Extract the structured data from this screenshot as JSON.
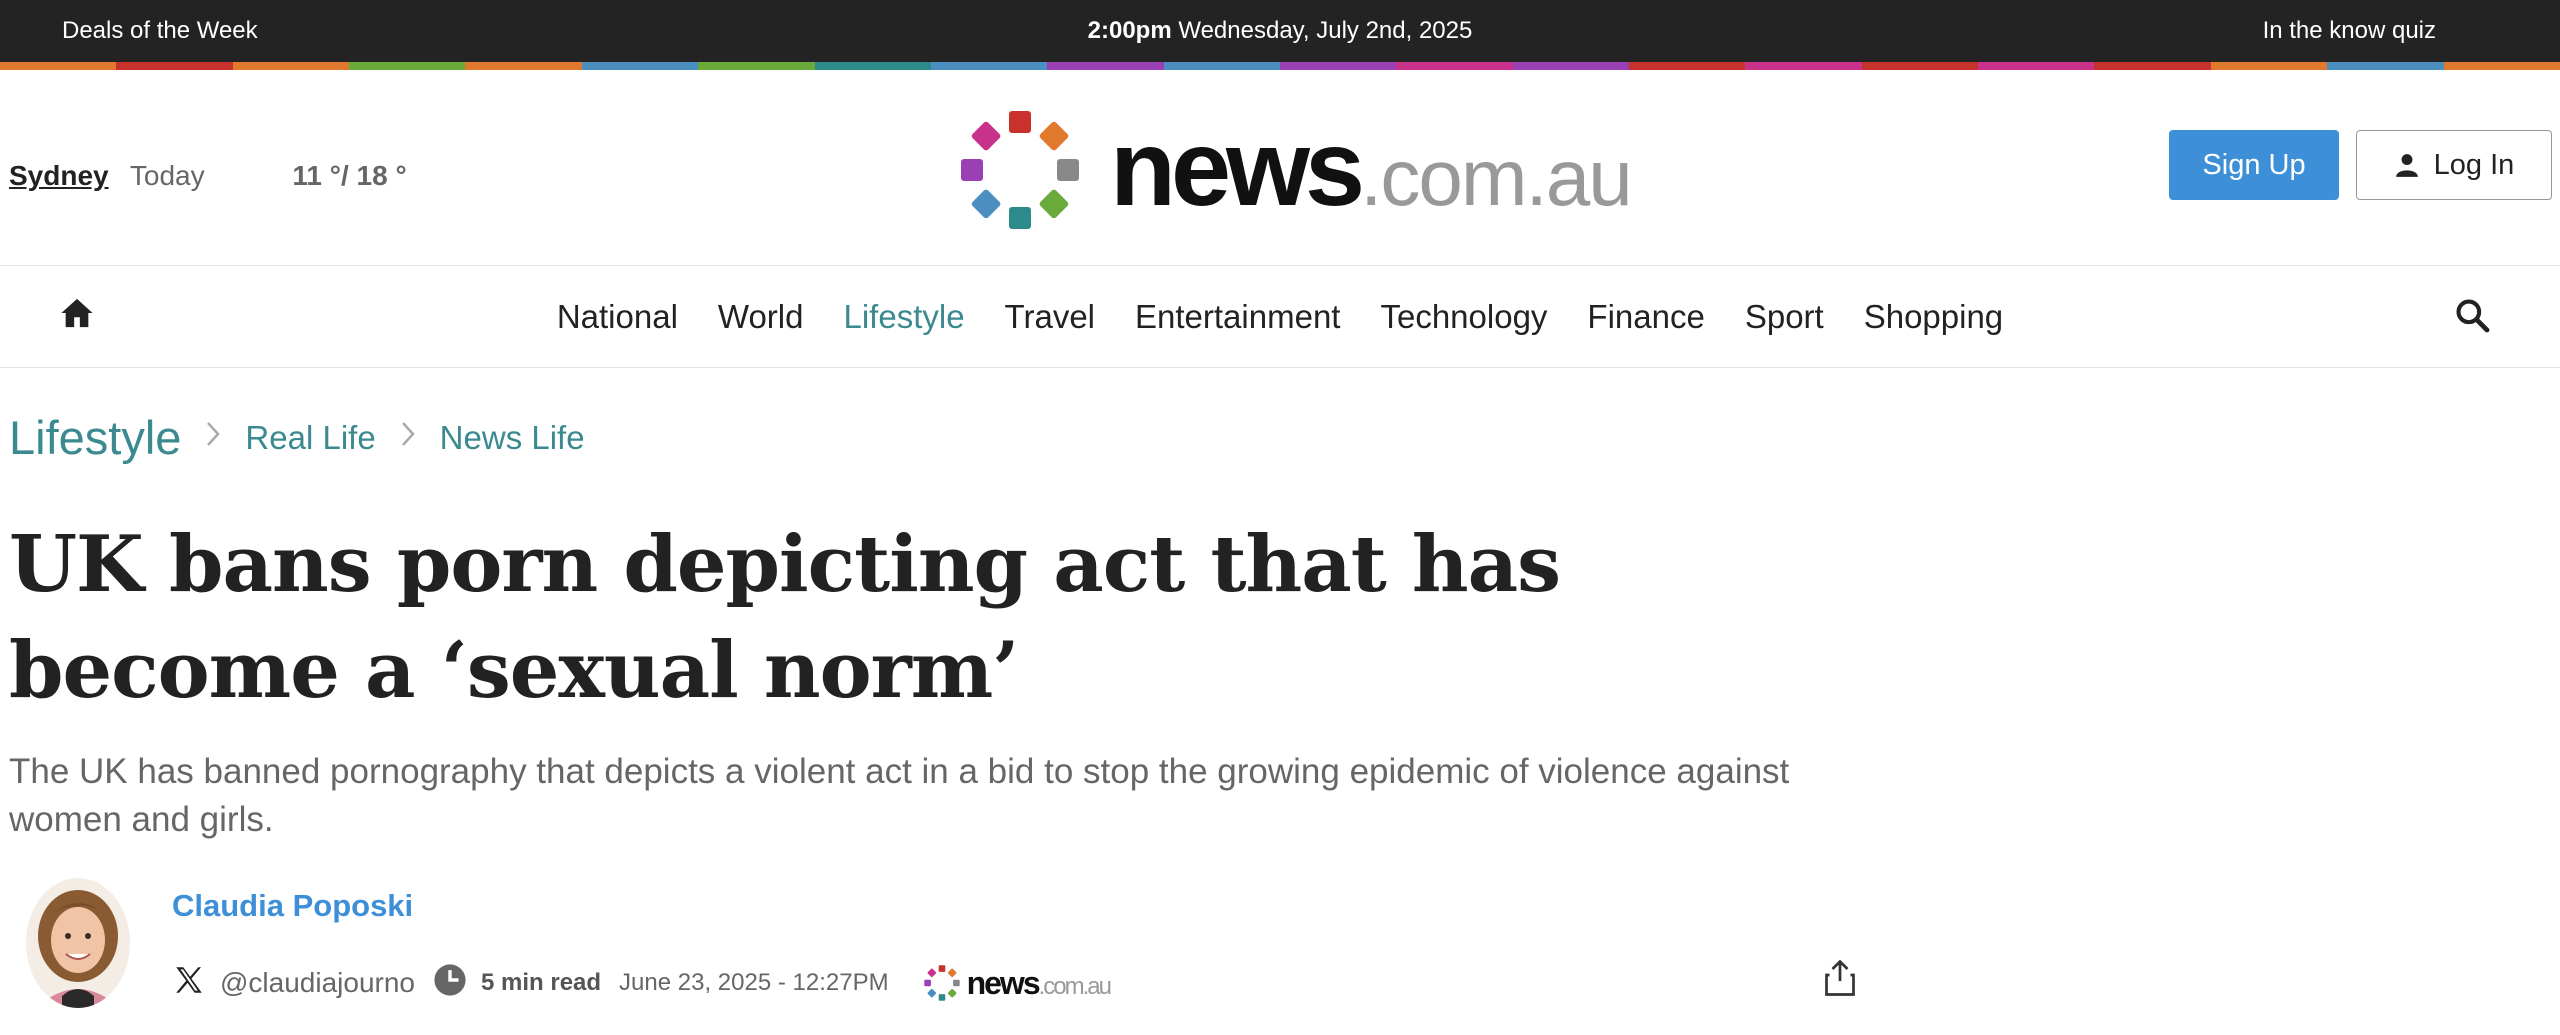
{
  "topbar": {
    "left_link": "Deals of the Week",
    "time": "2:00pm",
    "date": "Wednesday, July 2nd, 2025",
    "right_link": "In the know quiz"
  },
  "rainbow_colors": [
    "#e0792e",
    "#c9322c",
    "#e0792e",
    "#6aaa3a",
    "#e0792e",
    "#4a8fbf",
    "#6aaa3a",
    "#2e8b8b",
    "#4a8fbf",
    "#9b3fb5",
    "#4a8fbf",
    "#9b3fb5",
    "#c9328a",
    "#9b3fb5",
    "#c9322c",
    "#c9328a",
    "#c9322c",
    "#c9328a",
    "#c9322c",
    "#e0792e",
    "#4a8fbf",
    "#e0792e"
  ],
  "weather": {
    "city": "Sydney",
    "day": "Today",
    "temps": "11 °/ 18 °"
  },
  "logo": {
    "name": "news",
    "domain": ".com.au",
    "dot_colors": [
      "#c9322c",
      "#e0792e",
      "#888888",
      "#6aaa3a",
      "#2e8b8b",
      "#4a8fbf",
      "#9b3fb5",
      "#c9328a"
    ]
  },
  "auth": {
    "signup": "Sign Up",
    "login": "Log In"
  },
  "nav": {
    "items": [
      {
        "label": "National",
        "active": false
      },
      {
        "label": "World",
        "active": false
      },
      {
        "label": "Lifestyle",
        "active": true
      },
      {
        "label": "Travel",
        "active": false
      },
      {
        "label": "Entertainment",
        "active": false
      },
      {
        "label": "Technology",
        "active": false
      },
      {
        "label": "Finance",
        "active": false
      },
      {
        "label": "Sport",
        "active": false
      },
      {
        "label": "Shopping",
        "active": false
      }
    ],
    "home_icon": "home-icon",
    "search_icon": "search-icon"
  },
  "breadcrumb": {
    "level1": "Lifestyle",
    "level2": "Real Life",
    "level3": "News Life"
  },
  "article": {
    "headline": "UK bans porn depicting act that has become a ‘sexual norm’",
    "standfirst": "The UK has banned pornography that depicts a violent act in a bid to stop the growing epidemic of violence against women and girls.",
    "author": "Claudia Poposki",
    "handle": "@claudiajourno",
    "read_time": "5 min read",
    "published": "June 23, 2025 - 12:27PM",
    "source_name": "news",
    "source_domain": ".com.au"
  },
  "colors": {
    "accent_teal": "#3a8a8f",
    "accent_blue": "#3d8fd8",
    "topbar_bg": "#232323"
  }
}
